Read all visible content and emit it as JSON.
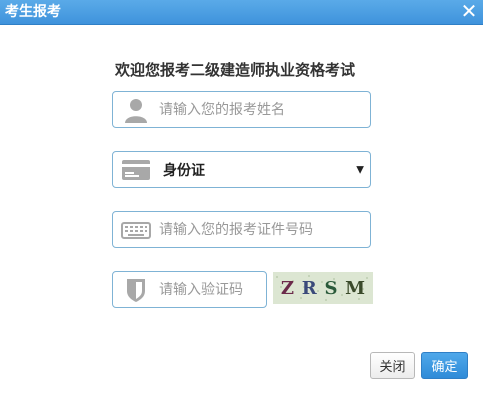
{
  "window": {
    "title": "考生报考",
    "close_symbol": "✕"
  },
  "form": {
    "welcome": "欢迎您报考二级建造师执业资格考试",
    "name_placeholder": "请输入您的报考姓名",
    "id_type_selected": "身份证",
    "id_number_placeholder": "请输入您的报考证件号码",
    "captcha_placeholder": "请输入验证码",
    "captcha_chars": [
      "Z",
      "R",
      "S",
      "M"
    ]
  },
  "buttons": {
    "close_label": "关闭",
    "ok_label": "确定"
  },
  "icons": {
    "name": "user-icon",
    "id_type": "id-card-icon",
    "id_number": "keyboard-icon",
    "captcha": "shield-icon"
  },
  "colors": {
    "titlebar": "#3f93dc",
    "field_border": "#7fb3d5",
    "icon_gray": "#999999",
    "ok_button": "#2f8bd8",
    "captcha_bg": "#d9e4cf"
  }
}
